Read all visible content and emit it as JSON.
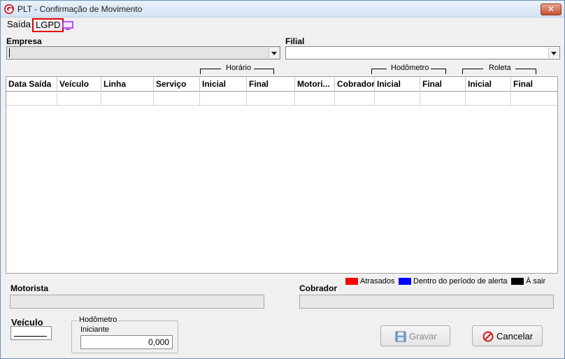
{
  "window": {
    "title": "PLT - Confirmação de Movimento",
    "close_glyph": "✕"
  },
  "menu": {
    "saida": "Saída",
    "lgpd": "LGPD"
  },
  "filters": {
    "empresa_label": "Empresa",
    "filial_label": "Filial"
  },
  "grid": {
    "groups": {
      "horario": "Horário",
      "hodometro": "Hodômetro",
      "roleta": "Roleta"
    },
    "columns": [
      "Data Saída",
      "Veículo",
      "Linha",
      "Serviço",
      "Inicial",
      "Final",
      "Motori...",
      "Cobrador",
      "Inicial",
      "Final",
      "Inicial",
      "Final"
    ]
  },
  "legend": {
    "items": [
      {
        "label": "Atrasados",
        "color": "#ff0000"
      },
      {
        "label": "Dentro do período de alerta",
        "color": "#0000ff"
      },
      {
        "label": "À sair",
        "color": "#000000"
      }
    ]
  },
  "details": {
    "motorista_label": "Motorista",
    "cobrador_label": "Cobrador",
    "veiculo_label": "Veículo",
    "hodometro_group": "Hodômetro",
    "iniciante_label": "Iniciante",
    "hodometro_value": "0,000"
  },
  "buttons": {
    "gravar": "Gravar",
    "cancelar": "Cancelar"
  },
  "colors": {
    "highlight_box": "#e00000",
    "brand_icon": "#c8202c"
  }
}
